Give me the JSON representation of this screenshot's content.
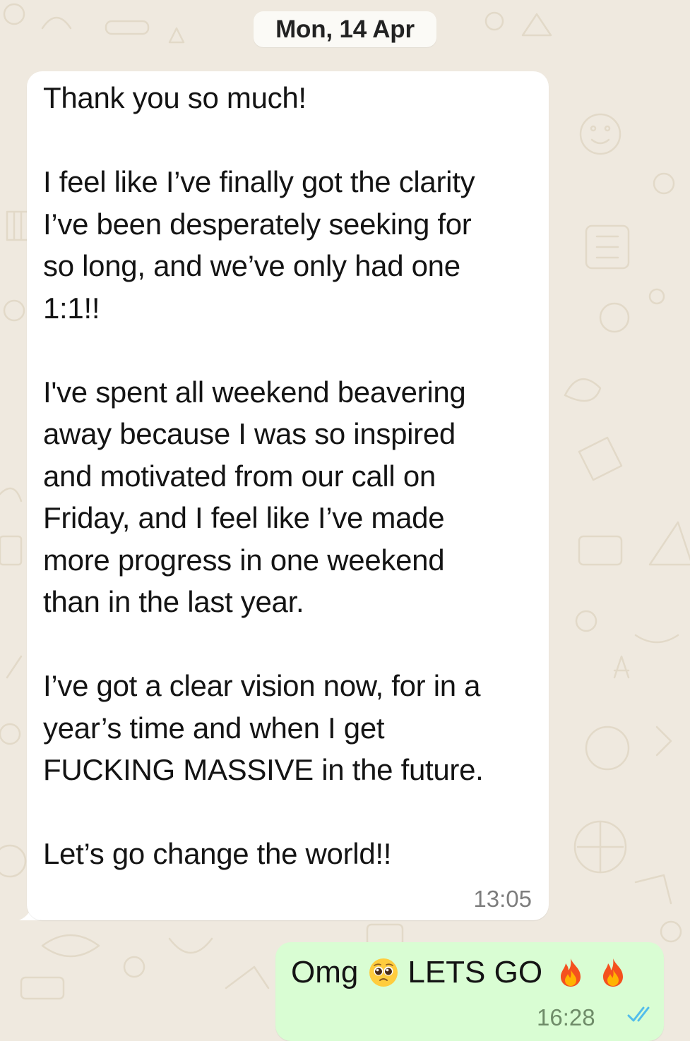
{
  "chat": {
    "date_separator": "Mon, 14 Apr",
    "incoming": {
      "text": "Thank you so much!\n\nI feel like I’ve finally got the clarity\nI’ve been desperately seeking for\nso long, and we’ve only had one\n1:1!!\n\nI've spent all weekend beavering\naway because I was so inspired\nand motivated from our call on\nFriday, and I feel like I’ve made\nmore progress in one weekend\nthan in the last year.\n\nI’ve got a clear vision now, for in a\nyear’s time and when I get\nFUCKING MASSIVE in the future.\n\nLet’s go change the world!!",
      "time": "13:05"
    },
    "outgoing": {
      "word1": "Omg",
      "word2": "LETS GO",
      "emojis": [
        "pleading-face-emoji",
        "fire-emoji",
        "fire-emoji"
      ],
      "time": "16:28",
      "status_icon": "double-check-read-icon"
    }
  },
  "colors": {
    "wallpaper": "#efe9df",
    "incoming_bubble": "#ffffff",
    "outgoing_bubble": "#d9fdd3",
    "read_ticks": "#53bdeb",
    "timestamp": "#7d7d7d"
  }
}
